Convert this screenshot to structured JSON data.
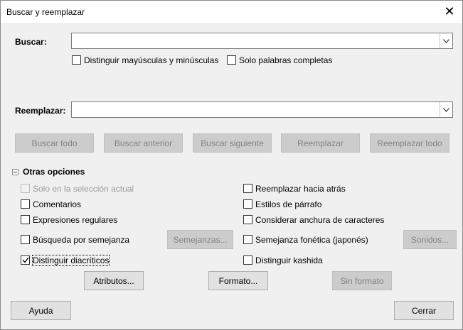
{
  "window": {
    "title": "Buscar y reemplazar"
  },
  "search": {
    "label": "Buscar:",
    "value": "",
    "placeholder": ""
  },
  "search_options": {
    "match_case": {
      "label": "Distinguir mayúsculas y minúsculas",
      "checked": false
    },
    "whole_words": {
      "label": "Solo palabras completas",
      "checked": false
    }
  },
  "replace": {
    "label": "Reemplazar:",
    "value": "",
    "placeholder": ""
  },
  "actions": {
    "find_all": "Buscar todo",
    "find_previous": "Buscar anterior",
    "find_next": "Buscar siguiente",
    "replace": "Reemplazar",
    "replace_all": "Reemplazar todo"
  },
  "other_options": {
    "title": "Otras opciones",
    "current_selection": {
      "label": "Solo en la selección actual",
      "checked": false
    },
    "comments": {
      "label": "Comentarios",
      "checked": false
    },
    "regex": {
      "label": "Expresiones regulares",
      "checked": false
    },
    "similarity": {
      "label": "Búsqueda por semejanza",
      "checked": false
    },
    "similarities_button": "Semejanzas...",
    "diacritics": {
      "label": "Distinguir diacríticos",
      "checked": true
    },
    "backwards": {
      "label": "Reemplazar hacia atrás",
      "checked": false
    },
    "paragraph_styles": {
      "label": "Estilos de párrafo",
      "checked": false
    },
    "char_width": {
      "label": "Considerar anchura de caracteres",
      "checked": false
    },
    "sounds_like": {
      "label": "Semejanza fonética (japonés)",
      "checked": false
    },
    "sounds_button": "Sonidos...",
    "kashida": {
      "label": "Distinguir kashida",
      "checked": false
    },
    "attributes_button": "Atributos...",
    "format_button": "Formato...",
    "no_format_button": "Sin formato"
  },
  "footer": {
    "help": "Ayuda",
    "close": "Cerrar"
  }
}
